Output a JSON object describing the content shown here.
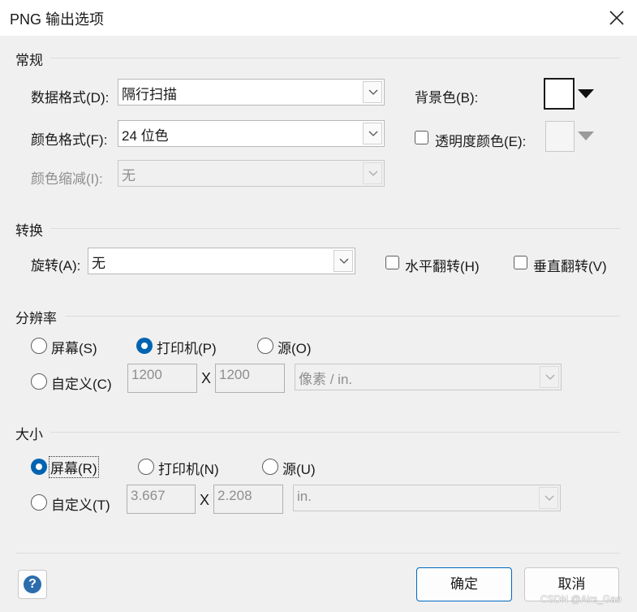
{
  "window": {
    "title": "PNG 输出选项"
  },
  "general": {
    "title": "常规",
    "data_format": {
      "label": "数据格式(D):",
      "value": "隔行扫描"
    },
    "color_format": {
      "label": "颜色格式(F):",
      "value": "24 位色"
    },
    "color_reduction": {
      "label": "颜色缩减(I):",
      "value": "无"
    },
    "background_color": {
      "label": "背景色(B):",
      "color": "#ffffff"
    },
    "transparency": {
      "label": "透明度颜色(E):",
      "checked": false
    }
  },
  "transform": {
    "title": "转换",
    "rotation": {
      "label": "旋转(A):",
      "value": "无"
    },
    "flip_h": {
      "label": "水平翻转(H)",
      "checked": false
    },
    "flip_v": {
      "label": "垂直翻转(V)",
      "checked": false
    }
  },
  "resolution": {
    "title": "分辨率",
    "screen": "屏幕(S)",
    "printer": "打印机(P)",
    "source": "源(O)",
    "custom": "自定义(C)",
    "selected": "printer",
    "width": "1200",
    "x_sep": "X",
    "height": "1200",
    "unit": "像素 / in."
  },
  "size": {
    "title": "大小",
    "screen": "屏幕(R)",
    "printer": "打印机(N)",
    "source": "源(U)",
    "custom": "自定义(T)",
    "selected": "screen",
    "width": "3.667",
    "x_sep": "X",
    "height": "2.208",
    "unit": "in."
  },
  "buttons": {
    "help": "?",
    "ok": "确定",
    "cancel": "取消"
  },
  "watermark": "CSDN @Airs_Gao",
  "colors": {
    "accent": "#0063b1",
    "primary_border": "#0067c0"
  }
}
